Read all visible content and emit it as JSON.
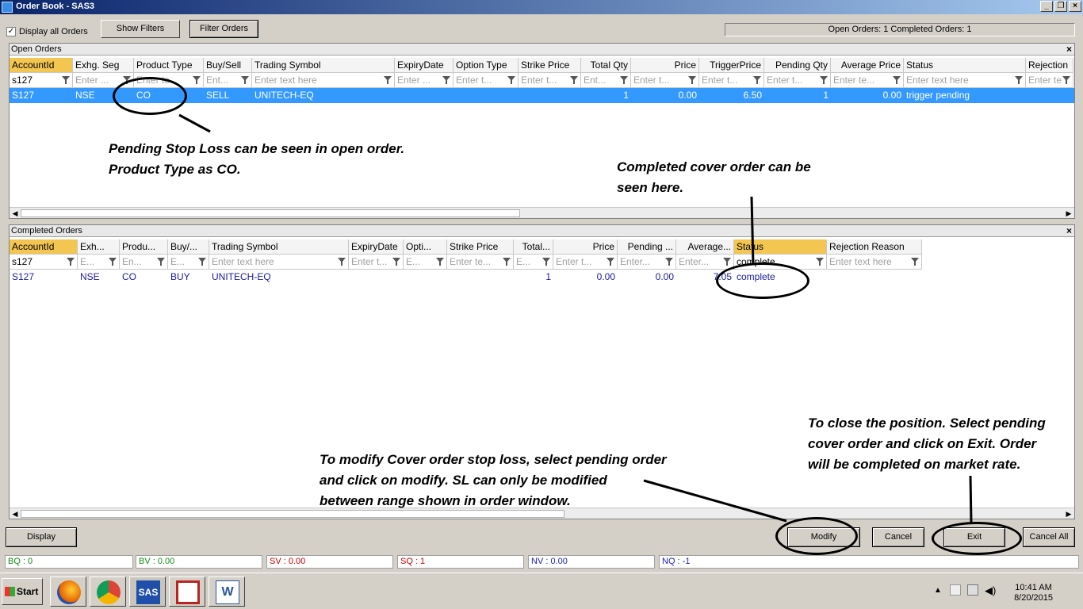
{
  "window": {
    "title": "Order Book - SAS3"
  },
  "toolbar": {
    "display_all_label": "Display all Orders",
    "show_filters": "Show Filters",
    "filter_orders": "Filter Orders",
    "counts": "Open Orders: 1   Completed Orders: 1"
  },
  "open_orders": {
    "title": "Open Orders",
    "columns": [
      "AccountId",
      "Exhg. Seg",
      "Product Type",
      "Buy/Sell",
      "Trading Symbol",
      "ExpiryDate",
      "Option Type",
      "Strike Price",
      "Total Qty",
      "Price",
      "TriggerPrice",
      "Pending Qty",
      "Average Price",
      "Status",
      "Rejection"
    ],
    "filters": [
      "s127",
      "Enter ...",
      "Enter te",
      "Ent...",
      "Enter text here",
      "Enter ...",
      "Enter t...",
      "Enter t...",
      "Ent...",
      "Enter t...",
      "Enter t...",
      "Enter t...",
      "Enter te...",
      "Enter text here",
      "Enter te"
    ],
    "rows": [
      [
        "S127",
        "NSE",
        "CO",
        "SELL",
        "UNITECH-EQ",
        "",
        "",
        "",
        "1",
        "0.00",
        "6.50",
        "1",
        "0.00",
        "trigger pending",
        ""
      ]
    ]
  },
  "completed_orders": {
    "title": "Completed Orders",
    "columns": [
      "AccountId",
      "Exh...",
      "Produ...",
      "Buy/...",
      "Trading Symbol",
      "ExpiryDate",
      "Opti...",
      "Strike Price",
      "Total...",
      "Price",
      "Pending ...",
      "Average...",
      "Status",
      "Rejection Reason"
    ],
    "filters": [
      "s127",
      "E...",
      "En...",
      "E...",
      "Enter text here",
      "Enter t...",
      "E...",
      "Enter te...",
      "E...",
      "Enter t...",
      "Enter...",
      "Enter...",
      "complete",
      "Enter text here"
    ],
    "rows": [
      [
        "S127",
        "NSE",
        "CO",
        "BUY",
        "UNITECH-EQ",
        "",
        "",
        "",
        "1",
        "0.00",
        "0.00",
        "7.05",
        "complete",
        ""
      ]
    ]
  },
  "annotations": {
    "open_line1": "Pending Stop Loss can be seen in open order.",
    "open_line2": "Product Type as CO.",
    "completed_line1": "Completed cover order can be",
    "completed_line2": "seen here.",
    "modify_line1": "To modify Cover order stop loss, select pending order",
    "modify_line2": "and click on modify. SL can only be modified",
    "modify_line3": "between range shown in order window.",
    "exit_line1": "To close the position. Select pending",
    "exit_line2": "cover order and click on Exit. Order",
    "exit_line3": "will be completed on market rate."
  },
  "buttons": {
    "display": "Display",
    "modify": "Modify",
    "cancel": "Cancel",
    "exit": "Exit",
    "cancel_all": "Cancel All"
  },
  "stats": {
    "bq": "BQ : 0",
    "bv": "BV : 0.00",
    "sv": "SV : 0.00",
    "sq": "SQ : 1",
    "nv": "NV : 0.00",
    "nq": "NQ : -1"
  },
  "stat_colors": {
    "buy": "#1a8a1a",
    "sell": "#cc0000",
    "net": "#1a1ad0"
  },
  "taskbar": {
    "start": "Start",
    "apps": [
      "firefox-icon",
      "chrome-icon",
      "sas-icon",
      "now-icon",
      "word-icon"
    ],
    "sas_label": "SAS",
    "time": "10:41 AM",
    "date": "8/20/2015"
  }
}
